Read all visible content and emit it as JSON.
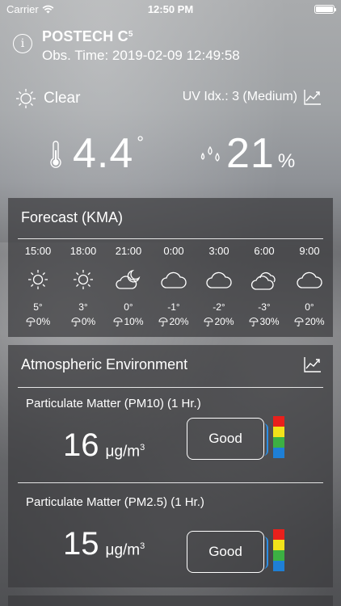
{
  "status_bar": {
    "carrier": "Carrier",
    "time": "12:50 PM"
  },
  "header": {
    "station": "POSTECH C",
    "station_sup": "5",
    "obs_time": "Obs. Time: 2019-02-09 12:49:58"
  },
  "current": {
    "condition": "Clear",
    "uv": "UV Idx.: 3 (Medium)",
    "temperature": "4.4",
    "temp_unit": "°",
    "humidity": "21",
    "humidity_unit": "%"
  },
  "forecast": {
    "title": "Forecast (KMA)",
    "items": [
      {
        "time": "15:00",
        "icon": "sun-icon",
        "temp": "5°",
        "rain": "0%"
      },
      {
        "time": "18:00",
        "icon": "sun-icon",
        "temp": "3°",
        "rain": "0%"
      },
      {
        "time": "21:00",
        "icon": "moon-cloud-icon",
        "temp": "0°",
        "rain": "10%"
      },
      {
        "time": "0:00",
        "icon": "cloud-icon",
        "temp": "-1°",
        "rain": "20%"
      },
      {
        "time": "3:00",
        "icon": "cloud-icon",
        "temp": "-2°",
        "rain": "20%"
      },
      {
        "time": "6:00",
        "icon": "clouds-icon",
        "temp": "-3°",
        "rain": "30%"
      },
      {
        "time": "9:00",
        "icon": "cloud-icon",
        "temp": "0°",
        "rain": "20%"
      }
    ]
  },
  "atmosphere": {
    "title": "Atmospheric Environment",
    "pm10": {
      "label": "Particulate Matter (PM10) (1 Hr.)",
      "value": "16",
      "unit": "μg/m",
      "unit_sup": "3",
      "grade": "Good"
    },
    "pm25": {
      "label": "Particulate Matter (PM2.5) (1 Hr.)",
      "value": "15",
      "unit": "μg/m",
      "unit_sup": "3",
      "grade": "Good"
    },
    "scale_colors": [
      "#e8201c",
      "#f2e21a",
      "#3cb043",
      "#1e7fd6"
    ]
  }
}
